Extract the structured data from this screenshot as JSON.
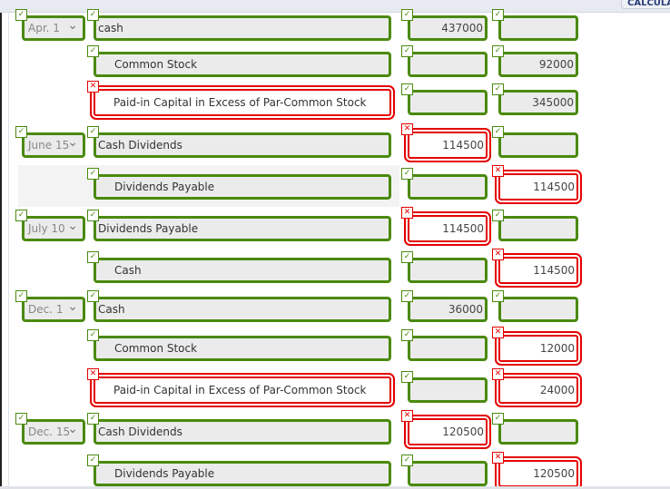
{
  "header": {
    "calculator_label": "CALCULAT"
  },
  "colors": {
    "correct": "#4a8a0e",
    "incorrect": "#e40000"
  },
  "rows": [
    {
      "date": "Apr. 1",
      "date_ok": true,
      "account": "cash",
      "indent": false,
      "account_ok": true,
      "debit": "437000",
      "debit_ok": true,
      "credit": "",
      "credit_ok": true
    },
    {
      "date": null,
      "account": "Common Stock",
      "indent": true,
      "account_ok": true,
      "debit": "",
      "debit_ok": true,
      "credit": "92000",
      "credit_ok": true
    },
    {
      "date": null,
      "account": "Paid-in Capital in Excess of Par-Common Stock",
      "indent": true,
      "account_ok": false,
      "debit": "",
      "debit_ok": true,
      "credit": "345000",
      "credit_ok": true
    },
    {
      "date": "June 15",
      "date_ok": true,
      "account": "Cash Dividends",
      "indent": false,
      "account_ok": true,
      "debit": "114500",
      "debit_ok": false,
      "credit": "",
      "credit_ok": true
    },
    {
      "date": null,
      "account": "Dividends Payable",
      "indent": true,
      "account_ok": true,
      "debit": "",
      "debit_ok": true,
      "credit": "114500",
      "credit_ok": false,
      "shaded": true
    },
    {
      "date": "July 10",
      "date_ok": true,
      "account": "Dividends Payable",
      "indent": false,
      "account_ok": true,
      "debit": "114500",
      "debit_ok": false,
      "credit": "",
      "credit_ok": true
    },
    {
      "date": null,
      "account": "Cash",
      "indent": true,
      "account_ok": true,
      "debit": "",
      "debit_ok": true,
      "credit": "114500",
      "credit_ok": false
    },
    {
      "date": "Dec. 1",
      "date_ok": true,
      "account": "Cash",
      "indent": false,
      "account_ok": true,
      "debit": "36000",
      "debit_ok": true,
      "credit": "",
      "credit_ok": true
    },
    {
      "date": null,
      "account": "Common Stock",
      "indent": true,
      "account_ok": true,
      "debit": "",
      "debit_ok": true,
      "credit": "12000",
      "credit_ok": false
    },
    {
      "date": null,
      "account": "Paid-in Capital in Excess of Par-Common Stock",
      "indent": true,
      "account_ok": false,
      "debit": "",
      "debit_ok": true,
      "credit": "24000",
      "credit_ok": false
    },
    {
      "date": "Dec. 15",
      "date_ok": true,
      "account": "Cash Dividends",
      "indent": false,
      "account_ok": true,
      "debit": "120500",
      "debit_ok": false,
      "credit": "",
      "credit_ok": true
    },
    {
      "date": null,
      "account": "Dividends Payable",
      "indent": true,
      "account_ok": true,
      "debit": "",
      "debit_ok": true,
      "credit": "120500",
      "credit_ok": false
    }
  ]
}
